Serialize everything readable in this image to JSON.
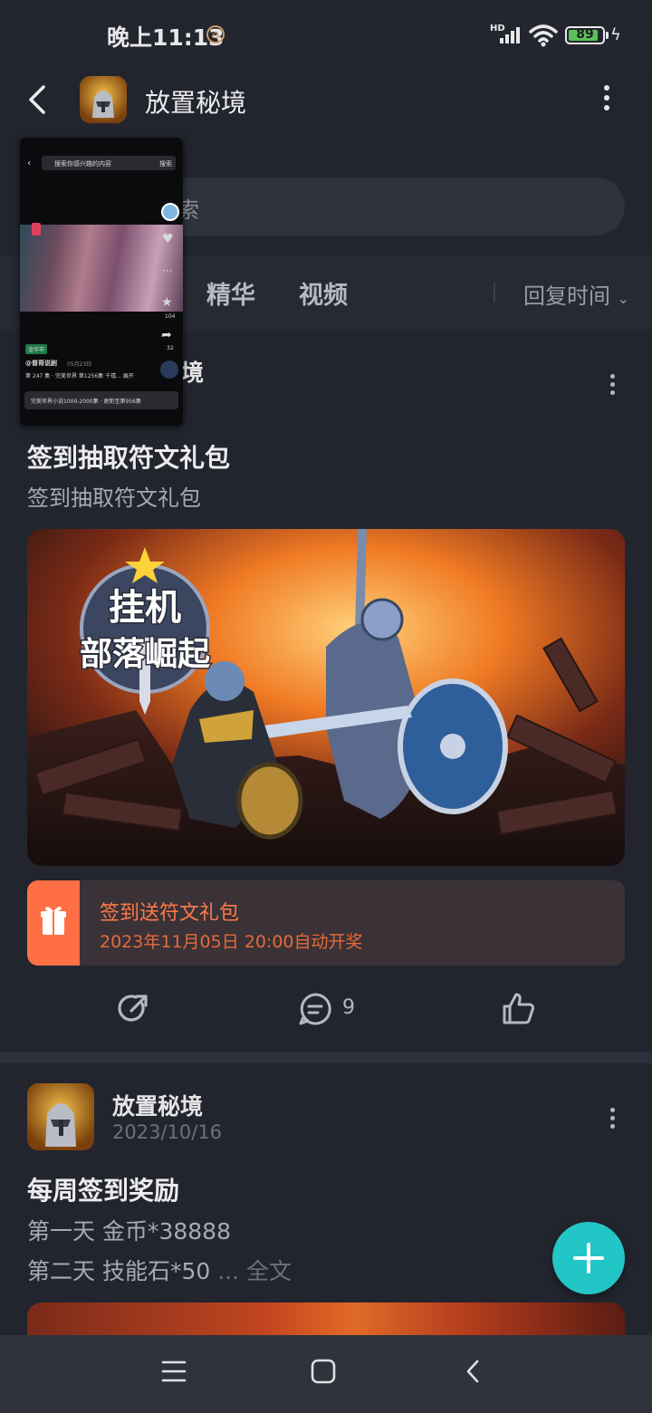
{
  "status_bar": {
    "time": "晚上11:13",
    "network": "HD",
    "battery": "89",
    "battery_level": 0.89
  },
  "header": {
    "title": "放置秘境",
    "icons": [
      "back-arrow-icon",
      "app-icon",
      "more-vertical-icon"
    ]
  },
  "search": {
    "placeholder_visible": "索"
  },
  "tabs": {
    "items": [
      "精华",
      "视频"
    ],
    "sort_label": "回复时间"
  },
  "post1": {
    "author_partial": "境",
    "date_partial": "",
    "title": "签到抽取符文礼包",
    "subtitle": "签到抽取符文礼包",
    "banner_text": [
      "挂机",
      "部落崛起"
    ],
    "gift": {
      "title": "签到送符文礼包",
      "time": "2023年11月05日 20:00自动开奖"
    },
    "comment_count": "9"
  },
  "post2": {
    "author": "放置秘境",
    "date": "2023/10/16",
    "title": "每周签到奖励",
    "lines": [
      "第一天 金币*38888",
      "第二天 技能石*50"
    ],
    "ellipsis": " ... ",
    "more_label": "全文"
  },
  "pip": {
    "search_placeholder": "搜索你感兴趣的内容",
    "search_button": "搜索",
    "caption": "@普哥说剧",
    "date": "05月23日",
    "desc": "第 247 集 · 完美世界 第1256集 千禧... 展开",
    "bottom_bar": "完美世界小说1000-2000集 · 更新至第956集",
    "side_counts": [
      "104",
      "32"
    ],
    "badge": "金华市"
  }
}
